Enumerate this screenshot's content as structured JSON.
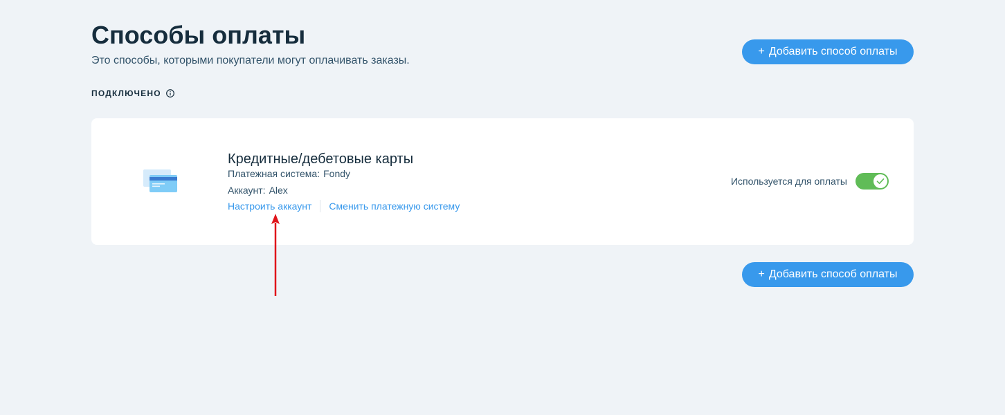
{
  "header": {
    "title": "Способы оплаты",
    "subtitle": "Это способы, которыми покупатели могут оплачивать заказы."
  },
  "add_button": {
    "plus": "+",
    "label": "Добавить способ оплаты"
  },
  "section": {
    "label": "ПОДКЛЮЧЕНО",
    "info_icon": "info-circle-icon"
  },
  "payment_method": {
    "icon": "credit-card-icon",
    "title": "Кредитные/дебетовые карты",
    "system_label": "Платежная система:",
    "system_value": "Fondy",
    "account_label": "Аккаунт:",
    "account_value": "Alex",
    "configure_link": "Настроить аккаунт",
    "change_link": "Сменить платежную систему",
    "usage_label": "Используется для оплаты",
    "enabled": true
  },
  "colors": {
    "background": "#eff3f7",
    "accent": "#3899ec",
    "toggle_on": "#60bc57",
    "annotation_arrow": "#e0151b"
  }
}
